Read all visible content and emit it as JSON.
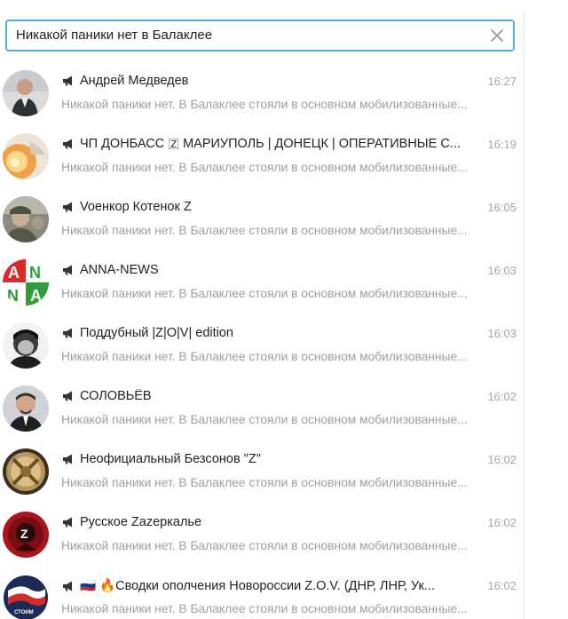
{
  "search": {
    "value": "Никакой паники нет в Балаклее",
    "clear_icon": "close-icon"
  },
  "results": [
    {
      "name": "Андрей Медведев",
      "time": "16:27",
      "preview": "Никакой паники нет. В Балаклее стояли в основном мобилизованные...",
      "avatar": "avatar-portrait"
    },
    {
      "name": "ЧП ДОНБАСС 🇿 МАРИУПОЛЬ | ДОНЕЦК | ОПЕРАТИВНЫЕ С...",
      "time": "16:19",
      "preview": "Никакой паники нет. В Балаклее стояли в основном мобилизованные...",
      "avatar": "avatar-explosion"
    },
    {
      "name": "Voенкор Котенок Z",
      "time": "16:05",
      "preview": "Никакой паники нет. В Балаклее стояли в основном мобилизованные...",
      "avatar": "avatar-soldier"
    },
    {
      "name": "ANNA-NEWS",
      "time": "16:03",
      "preview": "Никакой паники нет. В Балаклее стояли в основном мобилизованные...",
      "avatar": "avatar-anna-logo"
    },
    {
      "name": "Поддубный |Z|O|V| edition",
      "time": "16:03",
      "preview": "Никакой паники нет. В Балаклее стояли в основном мобилизованные...",
      "avatar": "avatar-bw-portrait"
    },
    {
      "name": "СОЛОВЬЁВ",
      "time": "16:02",
      "preview": "Никакой паники нет. В Балаклее стояли в основном мобилизованные...",
      "avatar": "avatar-portrait"
    },
    {
      "name": "Неофициальный Безсонов \"Z\"",
      "time": "16:02",
      "preview": "Никакой паники нет. В Балаклее стояли в основном мобилизованные...",
      "avatar": "avatar-emblem"
    },
    {
      "name": "Русское Zazеркалье",
      "time": "16:02",
      "preview": "Никакой паники нет. В Балаклее стояли в основном мобилизованные...",
      "avatar": "avatar-red-logo"
    },
    {
      "name": "🇷🇺 🔥Сводки ополчения Новороссии Z.O.V. (ДНР, ЛНР, Ук...",
      "time": "16:02",
      "preview": "Никакой паники нет. В Балаклее стояли в основном мобилизованные...",
      "avatar": "avatar-flag-logo"
    }
  ],
  "colors": {
    "accent": "#54a9eb",
    "name": "#222222",
    "preview": "#9aa0a6",
    "time": "#a7a7a7"
  }
}
